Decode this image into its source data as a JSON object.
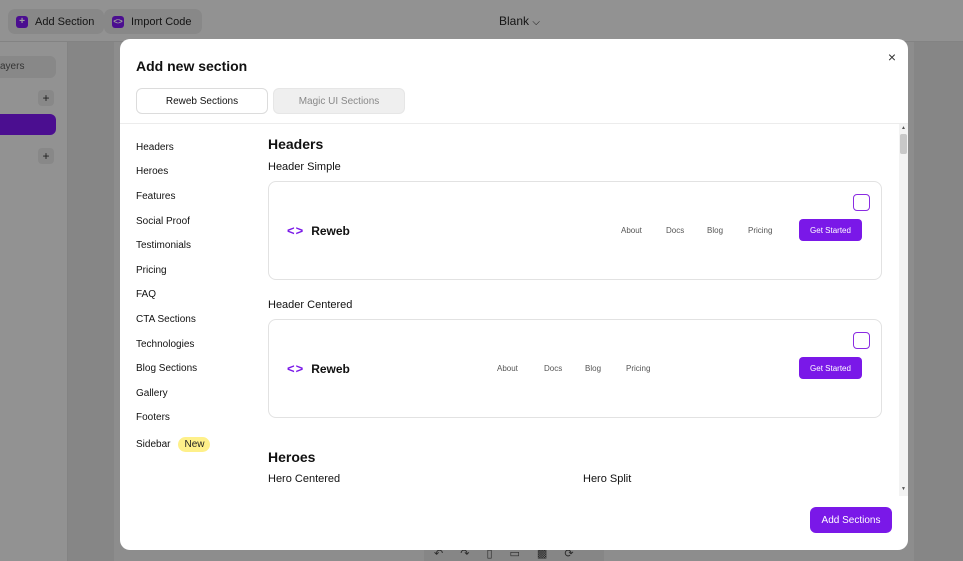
{
  "topbar": {
    "add_section_label": "Add Section",
    "import_code_label": "Import Code",
    "page_title": "Blank",
    "chevron": "⌄"
  },
  "left_panel": {
    "layers_label": "ayers",
    "plus": "+"
  },
  "modal": {
    "title": "Add new section",
    "close": "×",
    "tabs": [
      {
        "label": "Reweb Sections",
        "active": true
      },
      {
        "label": "Magic UI Sections",
        "active": false
      }
    ],
    "sidebar": [
      {
        "label": "Headers"
      },
      {
        "label": "Heroes"
      },
      {
        "label": "Features"
      },
      {
        "label": "Social Proof"
      },
      {
        "label": "Testimonials"
      },
      {
        "label": "Pricing"
      },
      {
        "label": "FAQ"
      },
      {
        "label": "CTA Sections"
      },
      {
        "label": "Technologies"
      },
      {
        "label": "Blog Sections"
      },
      {
        "label": "Gallery"
      },
      {
        "label": "Footers"
      },
      {
        "label": "Sidebar",
        "badge": "New"
      }
    ],
    "sections": {
      "headers_title": "Headers",
      "header_simple": {
        "title": "Header Simple",
        "logo_text": "Reweb",
        "logo_icon": "<>",
        "nav": [
          "About",
          "Docs",
          "Blog",
          "Pricing"
        ],
        "cta": "Get Started"
      },
      "header_centered": {
        "title": "Header Centered",
        "logo_text": "Reweb",
        "logo_icon": "<>",
        "nav": [
          "About",
          "Docs",
          "Blog",
          "Pricing"
        ],
        "cta": "Get Started"
      },
      "heroes_title": "Heroes",
      "hero_centered_title": "Hero Centered",
      "hero_split_title": "Hero Split"
    },
    "footer_button": "Add Sections"
  },
  "colors": {
    "accent": "#7a18e8",
    "badge": "#fef08a"
  }
}
